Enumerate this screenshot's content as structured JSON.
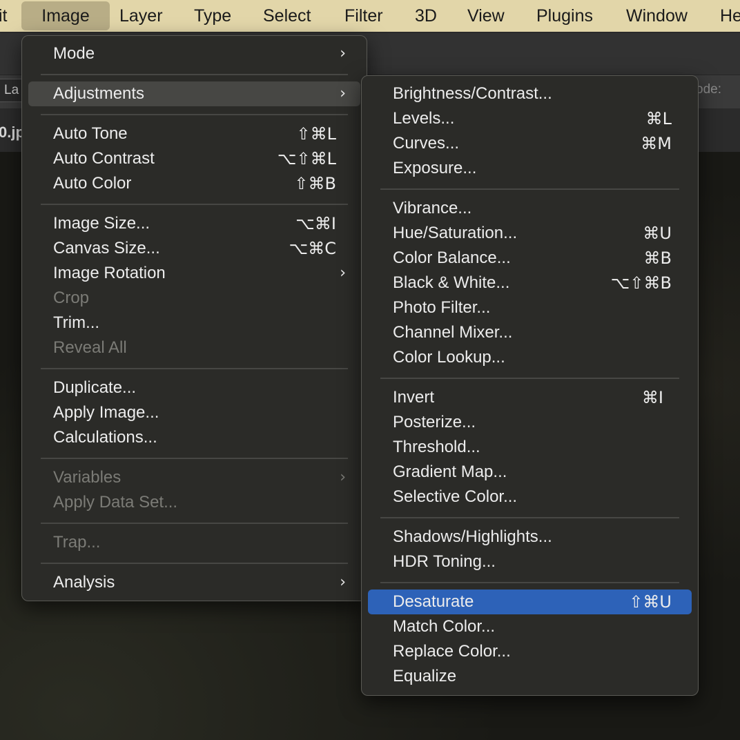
{
  "menubar": {
    "items": [
      "it",
      "Image",
      "Layer",
      "Type",
      "Select",
      "Filter",
      "3D",
      "View",
      "Plugins",
      "Window",
      "He"
    ]
  },
  "background": {
    "layer_fragment": "La",
    "doc_fragment": "0.jp",
    "mode_fragment": "ode:"
  },
  "image_menu": {
    "items": [
      {
        "label": "Mode",
        "submenu": true
      },
      {
        "label": "Adjustments",
        "submenu": true,
        "highlighted": true
      },
      {
        "label": "Auto Tone",
        "shortcut": "⇧⌘L"
      },
      {
        "label": "Auto Contrast",
        "shortcut": "⌥⇧⌘L"
      },
      {
        "label": "Auto Color",
        "shortcut": "⇧⌘B"
      },
      {
        "label": "Image Size...",
        "shortcut": "⌥⌘I"
      },
      {
        "label": "Canvas Size...",
        "shortcut": "⌥⌘C"
      },
      {
        "label": "Image Rotation",
        "submenu": true
      },
      {
        "label": "Crop",
        "disabled": true
      },
      {
        "label": "Trim..."
      },
      {
        "label": "Reveal All",
        "disabled": true
      },
      {
        "label": "Duplicate..."
      },
      {
        "label": "Apply Image..."
      },
      {
        "label": "Calculations..."
      },
      {
        "label": "Variables",
        "submenu": true,
        "disabled": true
      },
      {
        "label": "Apply Data Set...",
        "disabled": true
      },
      {
        "label": "Trap...",
        "disabled": true
      },
      {
        "label": "Analysis",
        "submenu": true
      }
    ],
    "submenu_arrow": "›"
  },
  "adjustments_menu": {
    "items": [
      {
        "label": "Brightness/Contrast..."
      },
      {
        "label": "Levels...",
        "shortcut": "⌘L"
      },
      {
        "label": "Curves...",
        "shortcut": "⌘M"
      },
      {
        "label": "Exposure..."
      },
      {
        "label": "Vibrance..."
      },
      {
        "label": "Hue/Saturation...",
        "shortcut": "⌘U"
      },
      {
        "label": "Color Balance...",
        "shortcut": "⌘B"
      },
      {
        "label": "Black & White...",
        "shortcut": "⌥⇧⌘B"
      },
      {
        "label": "Photo Filter..."
      },
      {
        "label": "Channel Mixer..."
      },
      {
        "label": "Color Lookup..."
      },
      {
        "label": "Invert",
        "shortcut": "⌘I"
      },
      {
        "label": "Posterize..."
      },
      {
        "label": "Threshold..."
      },
      {
        "label": "Gradient Map..."
      },
      {
        "label": "Selective Color..."
      },
      {
        "label": "Shadows/Highlights..."
      },
      {
        "label": "HDR Toning..."
      },
      {
        "label": "Desaturate",
        "shortcut": "⇧⌘U",
        "selected": true
      },
      {
        "label": "Match Color..."
      },
      {
        "label": "Replace Color..."
      },
      {
        "label": "Equalize"
      }
    ]
  },
  "colors": {
    "menubar_bg": "#e2d6a9",
    "menu_bg": "#2b2b28",
    "selection_blue": "#2d62b8",
    "hover_gray": "#474744",
    "disabled_text": "#7b7b76"
  }
}
